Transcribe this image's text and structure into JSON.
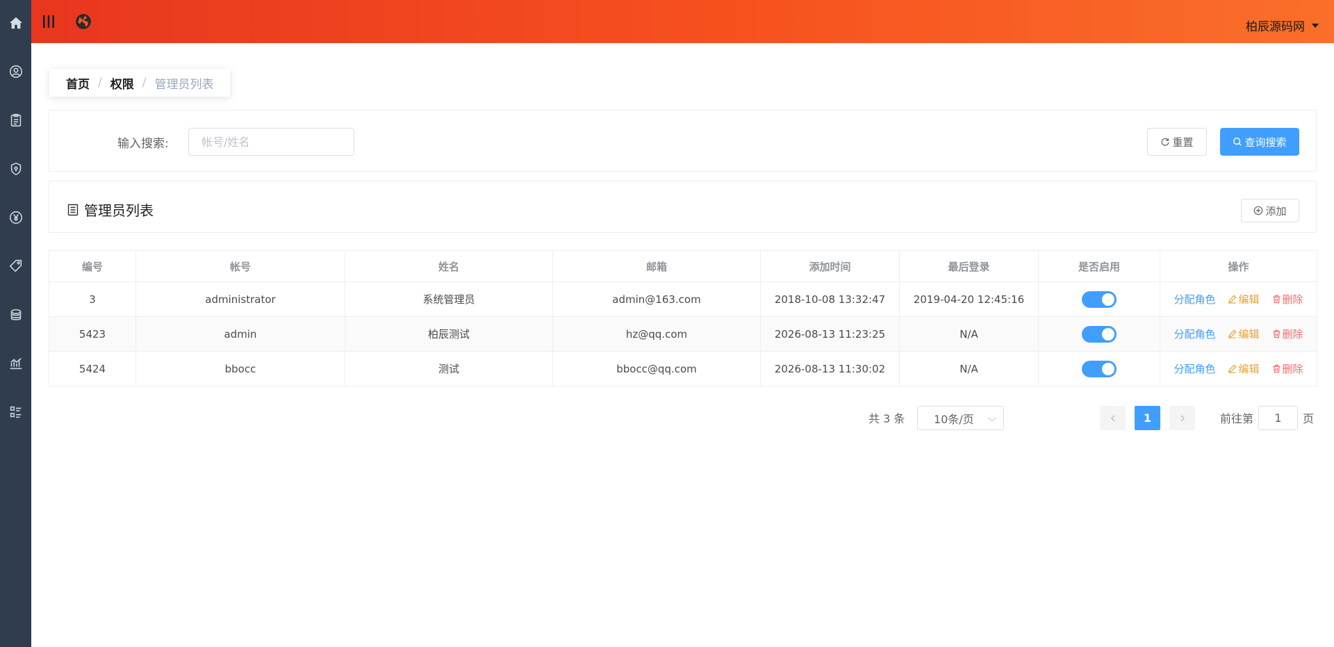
{
  "header": {
    "user_name": "柏辰源码网",
    "icons": [
      "menu-toggle-icon",
      "globe-icon"
    ]
  },
  "sidebar": {
    "items": [
      {
        "icon": "home-icon"
      },
      {
        "icon": "user-circle-icon"
      },
      {
        "icon": "clipboard-icon"
      },
      {
        "icon": "shield-icon"
      },
      {
        "icon": "yen-icon"
      },
      {
        "icon": "tag-icon"
      },
      {
        "icon": "coins-icon"
      },
      {
        "icon": "chart-icon"
      },
      {
        "icon": "list-grid-icon"
      }
    ]
  },
  "breadcrumb": {
    "home": "首页",
    "sep": "/",
    "parent": "权限",
    "current": "管理员列表"
  },
  "search": {
    "label": "输入搜索:",
    "placeholder": "帐号/姓名",
    "value": "",
    "reset_label": "重置",
    "search_label": "查询搜索"
  },
  "list": {
    "title": "管理员列表",
    "add_label": "添加"
  },
  "table": {
    "columns": [
      "编号",
      "帐号",
      "姓名",
      "邮箱",
      "添加时间",
      "最后登录",
      "是否启用",
      "操作"
    ],
    "rows": [
      {
        "id": "3",
        "account": "administrator",
        "name": "系统管理员",
        "email": "admin@163.com",
        "added": "2018-10-08 13:32:47",
        "last_login": "2019-04-20 12:45:16",
        "enabled": true
      },
      {
        "id": "5423",
        "account": "admin",
        "name": "柏辰测试",
        "email": "hz@qq.com",
        "added": "2026-08-13 11:23:25",
        "last_login": "N/A",
        "enabled": true
      },
      {
        "id": "5424",
        "account": "bbocc",
        "name": "测试",
        "email": "bbocc@qq.com",
        "added": "2026-08-13 11:30:02",
        "last_login": "N/A",
        "enabled": true
      }
    ],
    "ops": {
      "assign": "分配角色",
      "edit": "编辑",
      "delete": "删除"
    }
  },
  "pagination": {
    "total_label": "共 3 条",
    "page_size": "10条/页",
    "current_page": "1",
    "goto_prefix": "前往第",
    "goto_value": "1",
    "goto_suffix": "页"
  },
  "colors": {
    "primary": "#409eff",
    "sidebar": "#2f3d4e",
    "header_start": "#e8361f",
    "header_end": "#fa6f2a",
    "edit": "#e6a23c",
    "delete": "#f56c6c"
  }
}
